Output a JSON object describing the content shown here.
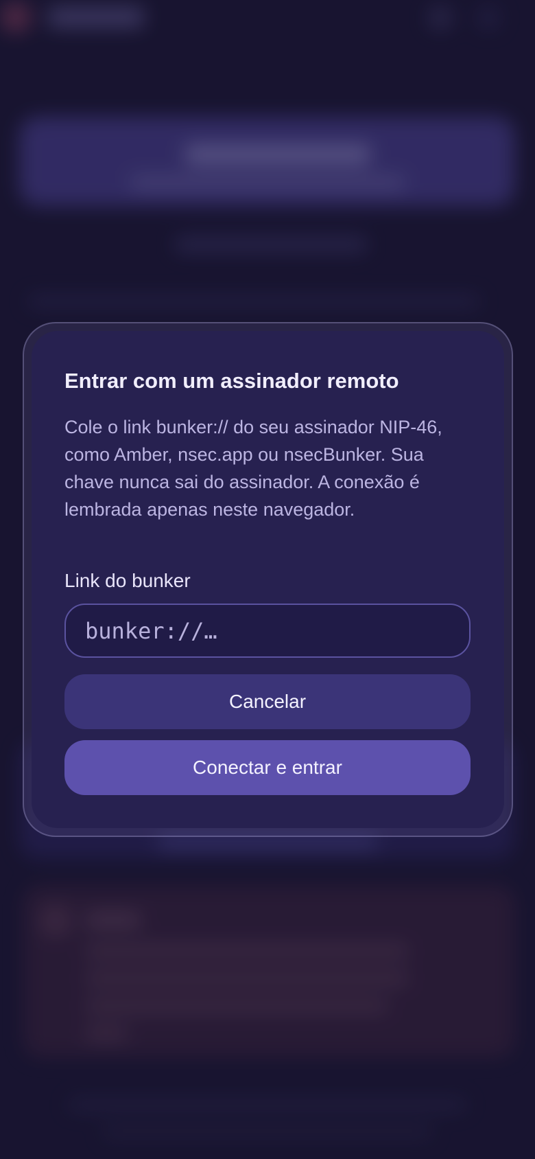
{
  "modal": {
    "title": "Entrar com um assinador remoto",
    "description": "Cole o link bunker:// do seu assinador NIP-46, como Amber, nsec.app ou nsecBunker. Sua chave nunca sai do assinador. A conexão é lembrada apenas neste navegador.",
    "field_label": "Link do bunker",
    "input_value": "",
    "input_placeholder": "bunker://…",
    "cancel_label": "Cancelar",
    "connect_label": "Conectar e entrar"
  },
  "colors": {
    "background": "#1c1836",
    "modal_background": "#272150",
    "cancel_button": "#3b3478",
    "connect_button": "#5d51ad",
    "title_text": "#f1eefc",
    "description_text": "#bcb5e2"
  }
}
